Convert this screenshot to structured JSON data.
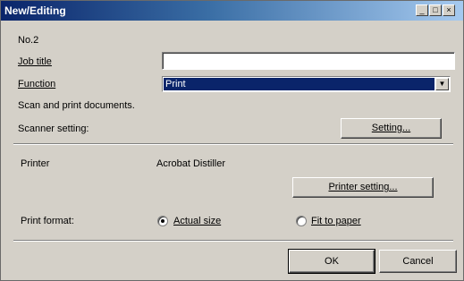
{
  "window": {
    "title": "New/Editing",
    "controls": [
      "_",
      "□",
      "×"
    ]
  },
  "form": {
    "number": "No.2",
    "job_title_label": "Job title",
    "job_title_value": "",
    "function_label": "Function",
    "function_value": "Print",
    "description": "Scan and print documents.",
    "scanner_label": "Scanner setting:",
    "scanner_button": "Setting...",
    "printer_label": "Printer",
    "printer_value": "Acrobat Distiller",
    "printer_button": "Printer setting...",
    "print_format_label": "Print format:",
    "options": [
      {
        "label": "Actual size",
        "selected": true
      },
      {
        "label": "Fit to paper",
        "selected": false
      }
    ]
  },
  "footer": {
    "ok": "OK",
    "cancel": "Cancel"
  }
}
